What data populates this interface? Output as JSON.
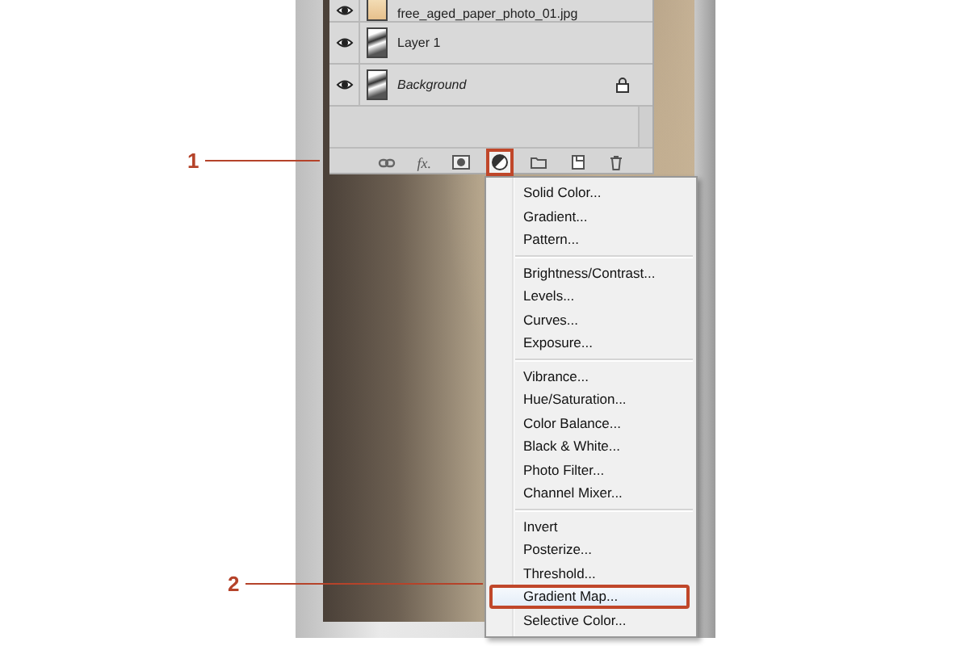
{
  "layers_panel": {
    "layers": [
      {
        "name": "free_aged_paper_photo_01.jpg",
        "kind": "image",
        "locked": false
      },
      {
        "name": "Layer 1",
        "kind": "layer",
        "locked": false
      },
      {
        "name": "Background",
        "kind": "background",
        "locked": true
      }
    ],
    "toolbar": [
      {
        "kind": "link",
        "selected": false
      },
      {
        "kind": "fx",
        "label": "fx.",
        "selected": false
      },
      {
        "kind": "mask",
        "selected": false
      },
      {
        "kind": "adjustment",
        "selected": true
      },
      {
        "kind": "folder",
        "selected": false
      },
      {
        "kind": "new",
        "selected": false
      },
      {
        "kind": "trash",
        "selected": false
      }
    ]
  },
  "menu": {
    "groups": [
      {
        "items": [
          {
            "label": "Solid Color...",
            "selected": false
          },
          {
            "label": "Gradient...",
            "selected": false
          },
          {
            "label": "Pattern...",
            "selected": false
          }
        ]
      },
      {
        "items": [
          {
            "label": "Brightness/Contrast...",
            "selected": false
          },
          {
            "label": "Levels...",
            "selected": false
          },
          {
            "label": "Curves...",
            "selected": false
          },
          {
            "label": "Exposure...",
            "selected": false
          }
        ]
      },
      {
        "items": [
          {
            "label": "Vibrance...",
            "selected": false
          },
          {
            "label": "Hue/Saturation...",
            "selected": false
          },
          {
            "label": "Color Balance...",
            "selected": false
          },
          {
            "label": "Black & White...",
            "selected": false
          },
          {
            "label": "Photo Filter...",
            "selected": false
          },
          {
            "label": "Channel Mixer...",
            "selected": false
          }
        ]
      },
      {
        "items": [
          {
            "label": "Invert",
            "selected": false
          },
          {
            "label": "Posterize...",
            "selected": false
          },
          {
            "label": "Threshold...",
            "selected": false
          },
          {
            "label": "Gradient Map...",
            "selected": true
          },
          {
            "label": "Selective Color...",
            "selected": false
          }
        ]
      }
    ]
  },
  "callouts": [
    {
      "number": "1"
    },
    {
      "number": "2"
    }
  ]
}
